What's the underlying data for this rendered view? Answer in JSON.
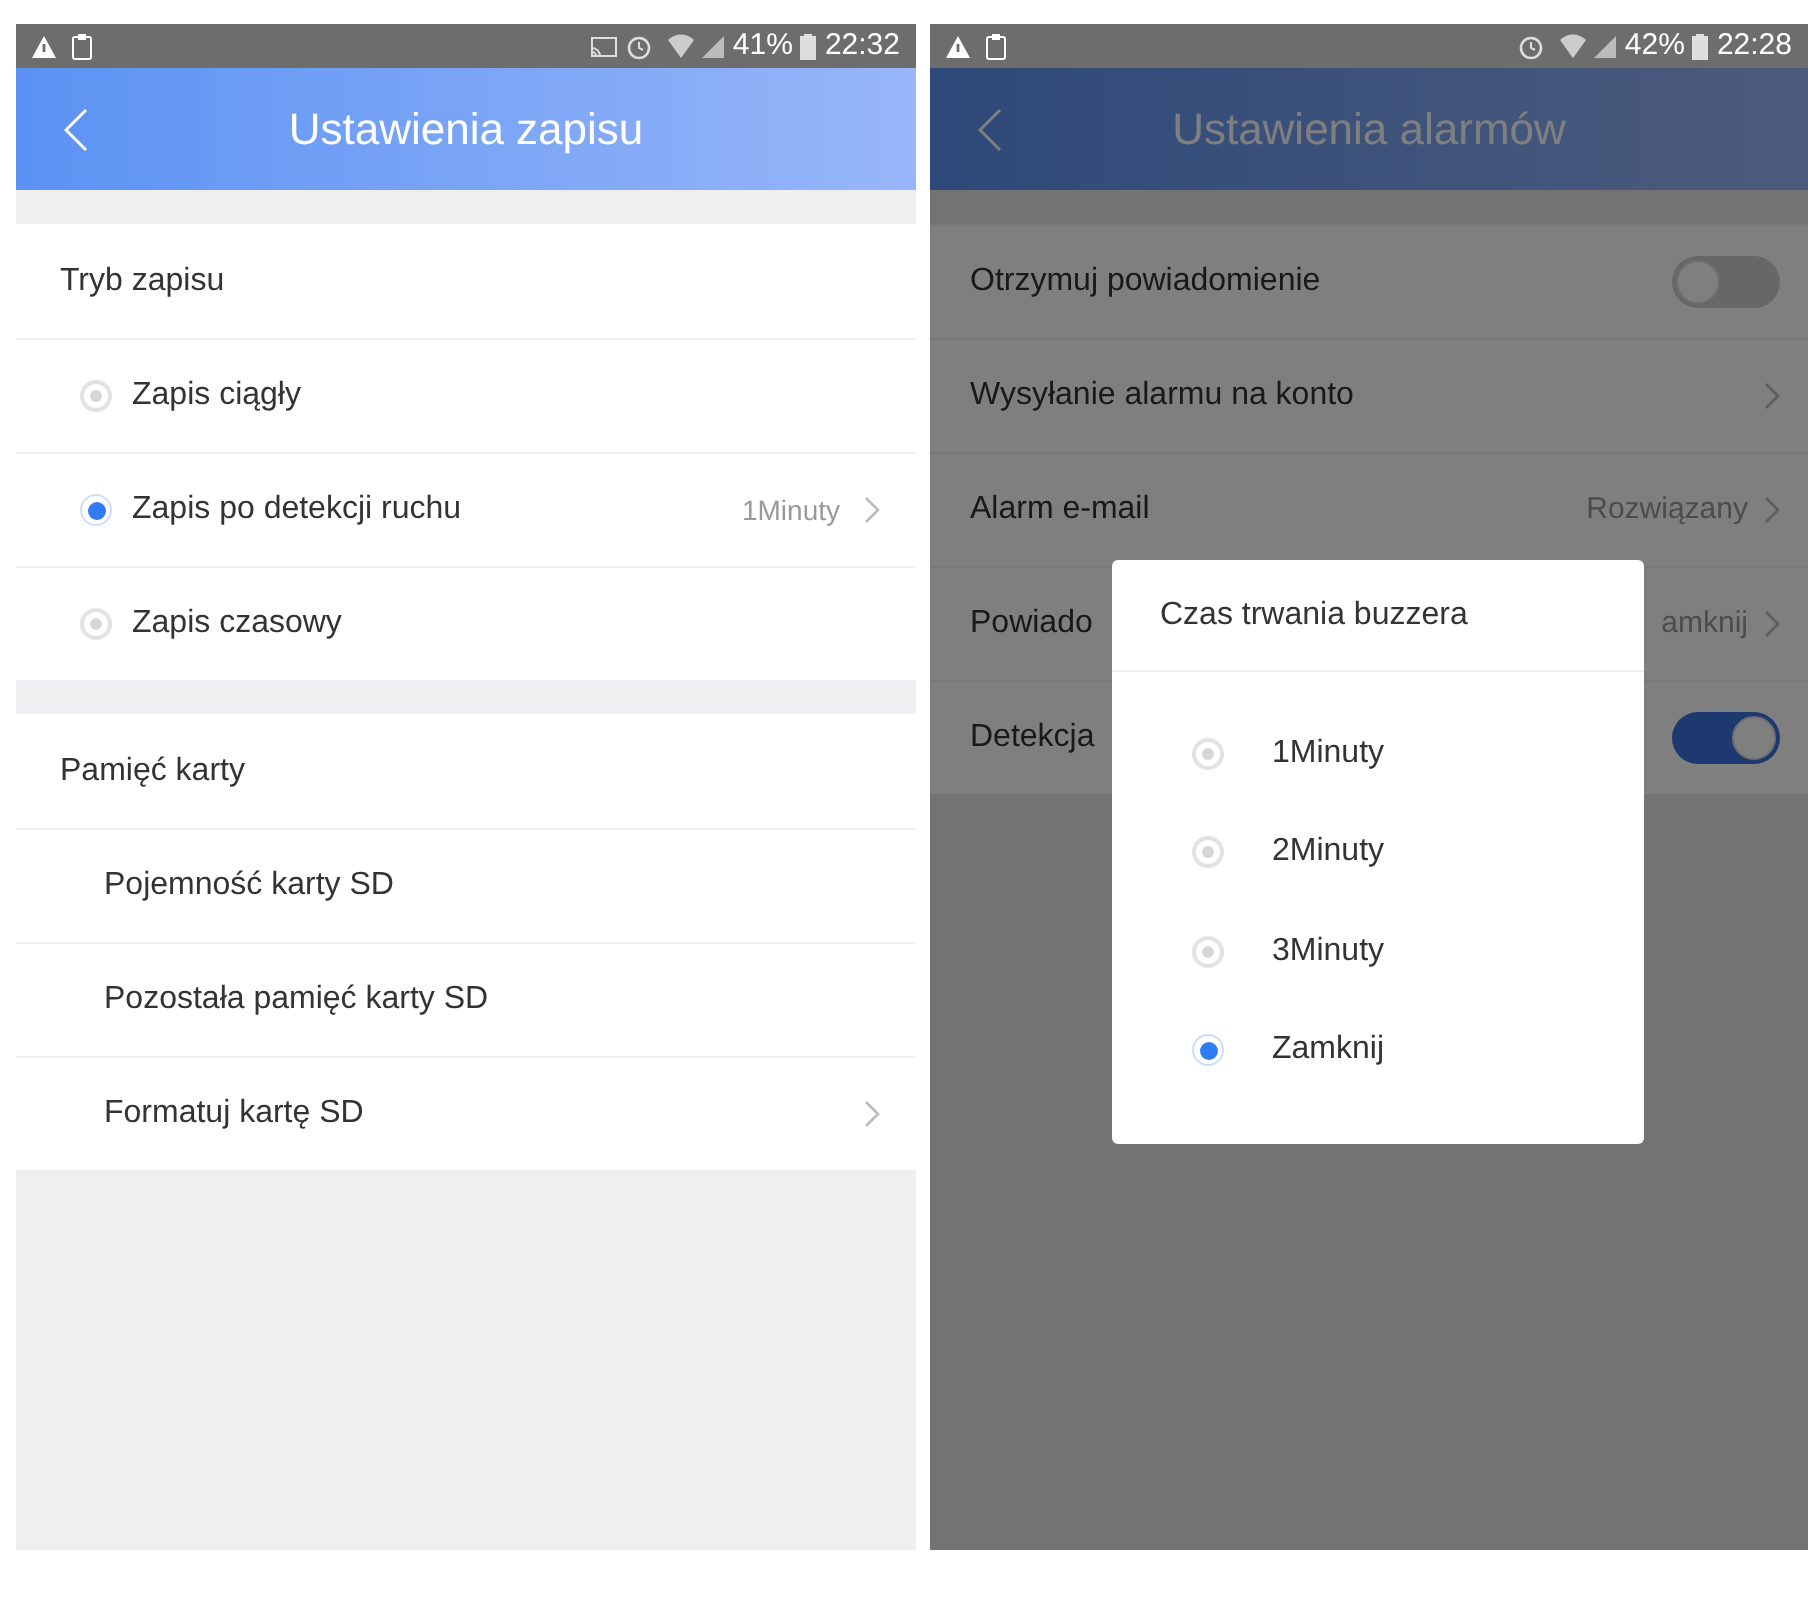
{
  "left_screen": {
    "status_bar": {
      "battery": "41%",
      "time": "22:32"
    },
    "title": "Ustawienia zapisu",
    "groups": [
      {
        "title": "Tryb zapisu",
        "rows": [
          {
            "kind": "radio",
            "label": "Zapis ciągły",
            "selected": false
          },
          {
            "kind": "radio",
            "label": "Zapis po detekcji ruchu",
            "value": "1Minuty",
            "selected": true
          },
          {
            "kind": "radio",
            "label": "Zapis czasowy",
            "selected": false
          }
        ]
      },
      {
        "title": "Pamięć karty",
        "rows": [
          {
            "kind": "plain",
            "label": "Pojemność karty SD"
          },
          {
            "kind": "plain",
            "label": "Pozostała pamięć karty SD"
          },
          {
            "kind": "link",
            "label": "Formatuj kartę SD"
          }
        ]
      }
    ]
  },
  "right_screen": {
    "status_bar": {
      "battery": "42%",
      "time": "22:28"
    },
    "title": "Ustawienia alarmów",
    "rows": [
      {
        "kind": "toggle",
        "label": "Otrzymuj powiadomienie",
        "on": false
      },
      {
        "kind": "link",
        "label": "Wysyłanie alarmu na konto"
      },
      {
        "kind": "link",
        "label": "Alarm e-mail",
        "value": "Rozwiązany"
      },
      {
        "kind": "link",
        "label": "Powiado",
        "value": "amknij"
      },
      {
        "kind": "toggle",
        "label": "Detekcja",
        "on": true
      }
    ],
    "dialog": {
      "title": "Czas trwania buzzera",
      "options": [
        {
          "label": "1Minuty",
          "selected": false
        },
        {
          "label": "2Minuty",
          "selected": false
        },
        {
          "label": "3Minuty",
          "selected": false
        },
        {
          "label": "Zamknij",
          "selected": true
        }
      ]
    }
  }
}
